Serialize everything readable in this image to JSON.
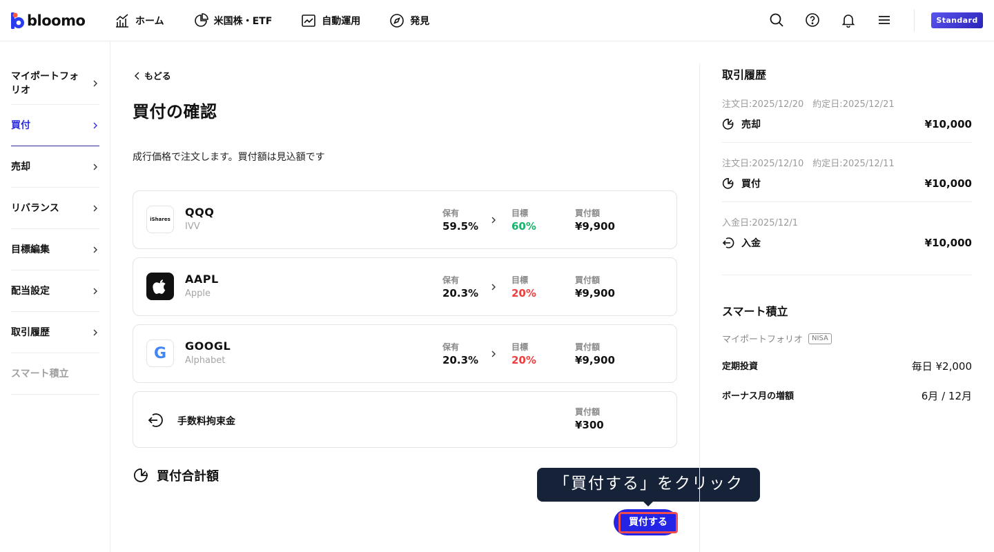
{
  "header": {
    "logo_text": "bloomo",
    "nav": [
      {
        "label": "ホーム"
      },
      {
        "label": "米国株・ETF"
      },
      {
        "label": "自動運用"
      },
      {
        "label": "発見"
      }
    ],
    "plan": "Standard"
  },
  "sidebar": {
    "items": [
      {
        "label": "マイポートフォリオ"
      },
      {
        "label": "買付"
      },
      {
        "label": "売却"
      },
      {
        "label": "リバランス"
      },
      {
        "label": "目標編集"
      },
      {
        "label": "配当設定"
      },
      {
        "label": "取引履歴"
      },
      {
        "label": "スマート積立"
      }
    ]
  },
  "main": {
    "back_label": "もどる",
    "title": "買付の確認",
    "subtitle": "成行価格で注文します。買付額は見込額です",
    "col_hold": "保有",
    "col_target": "目標",
    "col_buy": "買付額",
    "holdings": [
      {
        "ticker": "QQQ",
        "name": "IVV",
        "logo_text": "iShares",
        "hold": "59.5%",
        "target": "60%",
        "target_color": "green",
        "buy": "¥9,900"
      },
      {
        "ticker": "AAPL",
        "name": "Apple",
        "logo_text": "",
        "hold": "20.3%",
        "target": "20%",
        "target_color": "red",
        "buy": "¥9,900"
      },
      {
        "ticker": "GOOGL",
        "name": "Alphabet",
        "logo_text": "G",
        "hold": "20.3%",
        "target": "20%",
        "target_color": "red",
        "buy": "¥9,900"
      }
    ],
    "fee": {
      "label": "手数料拘束金",
      "buy_label": "買付額",
      "value": "¥300"
    },
    "total_label": "買付合計額",
    "tooltip": "「買付する」をクリック",
    "buy_button": "買付する"
  },
  "right": {
    "history_title": "取引履歴",
    "history": [
      {
        "date": "注文日:2025/12/20　約定日:2025/12/21",
        "type": "売却",
        "amount": "¥10,000"
      },
      {
        "date": "注文日:2025/12/10　約定日:2025/12/11",
        "type": "買付",
        "amount": "¥10,000"
      },
      {
        "date": "入金日:2025/12/1",
        "type": "入金",
        "amount": "¥10,000"
      }
    ],
    "smart_title": "スマート積立",
    "portfolio_label": "マイポートフォリオ",
    "nisa_badge": "NISA",
    "rows": [
      {
        "key": "定期投資",
        "value": "毎日 ¥2,000"
      },
      {
        "key": "ボーナス月の増額",
        "value": "6月 / 12月"
      }
    ]
  },
  "colors": {
    "accent": "#2424e6",
    "green": "#17b36b",
    "red": "#ef3d3d",
    "tooltip_bg": "#152238",
    "highlight": "#f24c4c"
  }
}
